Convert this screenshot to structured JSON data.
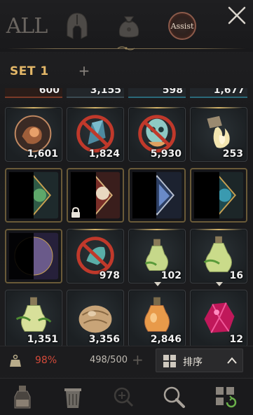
{
  "tabs": {
    "all_label": "ALL",
    "assist_label": "Assist"
  },
  "set": {
    "label": "SET 1",
    "add_symbol": "+"
  },
  "inventory": {
    "previous_row_counts": [
      "600",
      "3,155",
      "598",
      "1,677"
    ],
    "rows": [
      [
        {
          "icon": "fire-orb-icon",
          "count": "1,601",
          "blocked": false
        },
        {
          "icon": "blue-crystal-icon",
          "count": "1,824",
          "blocked": true
        },
        {
          "icon": "spirit-skull-icon",
          "count": "5,930",
          "blocked": true
        },
        {
          "icon": "flaming-scroll-icon",
          "count": "253",
          "blocked": false
        }
      ],
      [
        {
          "icon": "green-emblem-icon",
          "count": "",
          "locked": false
        },
        {
          "icon": "red-emblem-icon",
          "count": "",
          "locked": true
        },
        {
          "icon": "blue-emblem-icon",
          "count": "",
          "locked": false
        },
        {
          "icon": "teal-emblem-icon",
          "count": "",
          "locked": false
        }
      ],
      [
        {
          "icon": "purple-emblem-icon",
          "count": ""
        },
        {
          "icon": "teal-crystal-icon",
          "count": "978",
          "blocked": true
        },
        {
          "icon": "green-potion-icon",
          "count": "102"
        },
        {
          "icon": "green-potion-large-icon",
          "count": "16"
        }
      ],
      [
        {
          "icon": "green-flask-icon",
          "count": "1,351"
        },
        {
          "icon": "seed-pouch-icon",
          "count": "3,356"
        },
        {
          "icon": "orange-potion-icon",
          "count": "2,846"
        },
        {
          "icon": "pink-crystal-icon",
          "count": "12"
        }
      ]
    ]
  },
  "status": {
    "weight_percent": "98%",
    "slots": "498/500",
    "add_symbol": "+",
    "sort_label": "排序"
  },
  "colors": {
    "accent_gold": "#e3b768",
    "weight_red": "#d34a3a"
  }
}
